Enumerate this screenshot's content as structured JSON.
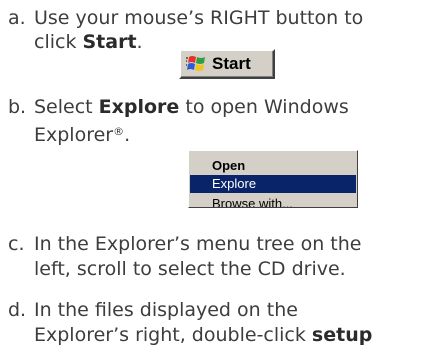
{
  "steps": [
    {
      "letter": "a.",
      "line1": "Use your mouse’s RIGHT button to",
      "line2_prefix": "click ",
      "line2_bold": "Start",
      "line2_suffix": "."
    },
    {
      "letter": "b.",
      "line1_prefix": "Select ",
      "line1_bold": "Explore",
      "line1_suffix": " to open Windows",
      "line2": "Explorer",
      "line2_sup": "®",
      "line2_suffix": "."
    },
    {
      "letter": "c.",
      "line1": "In the Explorer’s menu tree on the",
      "line2": "left, scroll to select the CD drive."
    },
    {
      "letter": "d.",
      "line1": "In the files displayed on the",
      "line2_prefix": "Explorer’s right, double-click ",
      "line2_bold": "setup"
    }
  ],
  "start_button": {
    "label": "Start",
    "icon": "windows-logo-icon"
  },
  "context_menu": {
    "items": [
      "Open",
      "Explore",
      "Browse with..."
    ],
    "selected": "Explore",
    "highlight_color": "#0a246a"
  }
}
